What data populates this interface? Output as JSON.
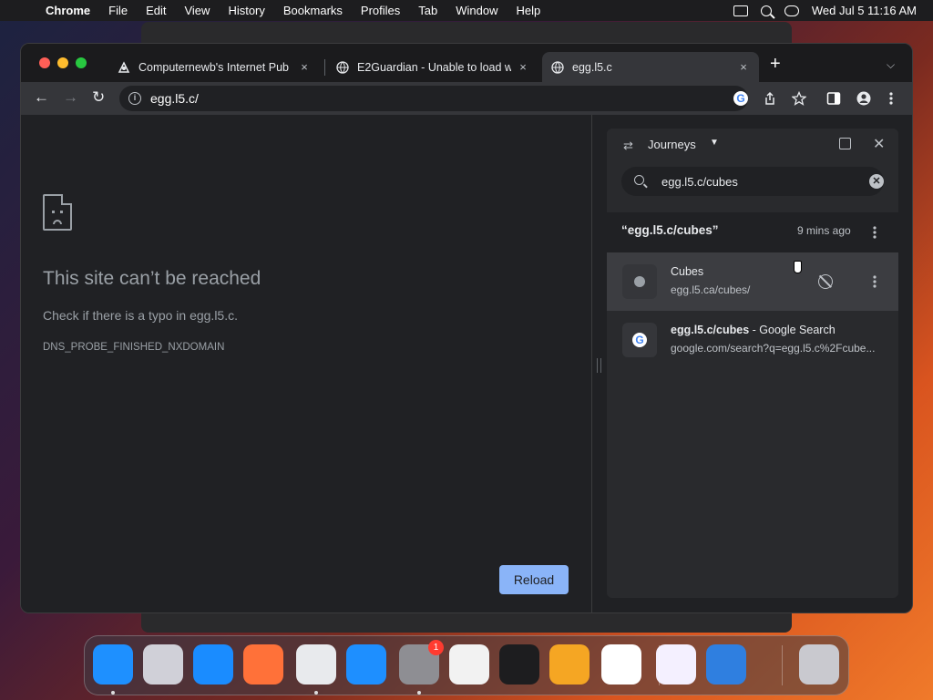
{
  "menubar": {
    "app_name": "Chrome",
    "items": [
      "File",
      "Edit",
      "View",
      "History",
      "Bookmarks",
      "Profiles",
      "Tab",
      "Window",
      "Help"
    ],
    "clock": "Wed Jul 5  11:16 AM"
  },
  "tabs": [
    {
      "title": "Computernewb's Internet Pub",
      "close": "×"
    },
    {
      "title": "E2Guardian - Unable to load w",
      "close": "×"
    },
    {
      "title": "egg.l5.c",
      "close": "×",
      "active": true
    }
  ],
  "toolbar": {
    "back": "←",
    "forward": "→",
    "reload": "↻",
    "url": "egg.l5.c/",
    "new_tab": "+"
  },
  "error_page": {
    "title": "This site can’t be reached",
    "message": "Check if there is a typo in egg.l5.c.",
    "code": "DNS_PROBE_FINISHED_NXDOMAIN",
    "reload_label": "Reload"
  },
  "side_panel": {
    "title": "Journeys",
    "search_value": "egg.l5.c/cubes",
    "cluster": {
      "title": "“egg.l5.c/cubes”",
      "time": "9 mins ago"
    },
    "results": [
      {
        "title": "Cubes",
        "title_suffix": "",
        "url": "egg.l5.ca/cubes/",
        "icon": "globe-icon"
      },
      {
        "title": "egg.l5.c/cubes",
        "title_suffix": " - Google Search",
        "url": "google.com/search?q=egg.l5.c%2Fcube...",
        "icon": "google-icon"
      }
    ]
  },
  "dock": {
    "apps": [
      {
        "name": "finder",
        "color": "#1e90ff"
      },
      {
        "name": "launchpad",
        "color": "#d0d0d8"
      },
      {
        "name": "safari",
        "color": "#1a8cff"
      },
      {
        "name": "firefox",
        "color": "#ff7139"
      },
      {
        "name": "chrome",
        "color": "#e8eaed"
      },
      {
        "name": "app-store",
        "color": "#1e8fff"
      },
      {
        "name": "system-settings",
        "color": "#8e8e93"
      },
      {
        "name": "textedit",
        "color": "#f2f2f2"
      },
      {
        "name": "terminal",
        "color": "#1d1d1f"
      },
      {
        "name": "garageband",
        "color": "#f5a623"
      },
      {
        "name": "vscode",
        "color": "#ffffff"
      },
      {
        "name": "visual-studio",
        "color": "#f4f0ff"
      },
      {
        "name": "weather",
        "color": "#2f7fe0"
      },
      {
        "name": "trash",
        "color": "#c9c9cf"
      }
    ],
    "settings_badge": "1"
  }
}
